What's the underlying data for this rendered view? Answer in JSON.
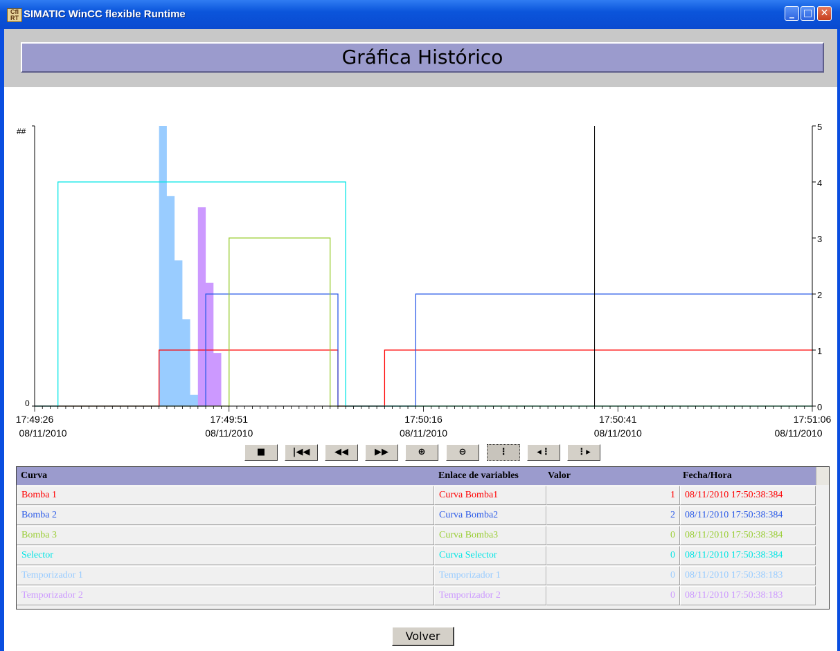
{
  "window": {
    "title": "SIMATIC WinCC flexible Runtime",
    "icon_text": "Cfl RT"
  },
  "header": {
    "title": "Gráfica Histórico"
  },
  "chart_data": {
    "type": "line",
    "step": true,
    "y_left": {
      "label": "##",
      "ticks": [
        "0"
      ]
    },
    "y_right": {
      "ylim": [
        0,
        5
      ],
      "ticks": [
        0,
        1,
        2,
        3,
        4,
        5
      ]
    },
    "x_ticks": [
      {
        "time": "17:49:26",
        "date": "08/11/2010"
      },
      {
        "time": "17:49:51",
        "date": "08/11/2010"
      },
      {
        "time": "17:50:16",
        "date": "08/11/2010"
      },
      {
        "time": "17:50:41",
        "date": "08/11/2010"
      },
      {
        "time": "17:51:06",
        "date": "08/11/2010"
      }
    ],
    "xlim": [
      "17:49:26",
      "17:51:06"
    ],
    "cursor_time": "17:50:38",
    "series": [
      {
        "name": "Bomba 1",
        "color": "#ff0000",
        "type": "line",
        "points": [
          [
            "17:49:26",
            0
          ],
          [
            "17:49:42",
            0
          ],
          [
            "17:49:42",
            1
          ],
          [
            "17:50:05",
            1
          ],
          [
            "17:50:05",
            0
          ],
          [
            "17:50:11",
            0
          ],
          [
            "17:50:11",
            1
          ],
          [
            "17:51:06",
            1
          ]
        ]
      },
      {
        "name": "Bomba 2",
        "color": "#2a5ae8",
        "type": "line",
        "points": [
          [
            "17:49:26",
            0
          ],
          [
            "17:49:48",
            0
          ],
          [
            "17:49:48",
            2
          ],
          [
            "17:50:05",
            2
          ],
          [
            "17:50:05",
            0
          ],
          [
            "17:50:15",
            0
          ],
          [
            "17:50:15",
            2
          ],
          [
            "17:51:06",
            2
          ]
        ]
      },
      {
        "name": "Bomba 3",
        "color": "#9acd32",
        "type": "line",
        "points": [
          [
            "17:49:26",
            0
          ],
          [
            "17:49:51",
            0
          ],
          [
            "17:49:51",
            3
          ],
          [
            "17:50:04",
            3
          ],
          [
            "17:50:04",
            0
          ],
          [
            "17:51:06",
            0
          ]
        ]
      },
      {
        "name": "Selector",
        "color": "#00e5e5",
        "type": "line",
        "points": [
          [
            "17:49:26",
            0
          ],
          [
            "17:49:29",
            0
          ],
          [
            "17:49:29",
            4
          ],
          [
            "17:50:06",
            4
          ],
          [
            "17:50:06",
            0
          ],
          [
            "17:51:06",
            0
          ]
        ]
      },
      {
        "name": "Temporizador 1",
        "color": "#99ccff",
        "type": "area",
        "points": [
          [
            "17:49:42",
            0
          ],
          [
            "17:49:42",
            5
          ],
          [
            "17:49:43",
            5
          ],
          [
            "17:49:43",
            3.75
          ],
          [
            "17:49:44",
            3.75
          ],
          [
            "17:49:44",
            2.6
          ],
          [
            "17:49:45",
            2.6
          ],
          [
            "17:49:45",
            1.55
          ],
          [
            "17:49:46",
            1.55
          ],
          [
            "17:49:46",
            0.2
          ],
          [
            "17:49:48",
            0.2
          ],
          [
            "17:49:48",
            0
          ]
        ]
      },
      {
        "name": "Temporizador 2",
        "color": "#cc99ff",
        "type": "area",
        "points": [
          [
            "17:49:47",
            0
          ],
          [
            "17:49:47",
            3.55
          ],
          [
            "17:49:48",
            3.55
          ],
          [
            "17:49:48",
            2.2
          ],
          [
            "17:49:49",
            2.2
          ],
          [
            "17:49:49",
            0.95
          ],
          [
            "17:49:50",
            0.95
          ],
          [
            "17:49:50",
            0
          ]
        ]
      }
    ]
  },
  "toolbar": {
    "buttons": [
      {
        "name": "stop-button",
        "glyph": "■"
      },
      {
        "name": "first-button",
        "glyph": "|◀◀"
      },
      {
        "name": "rewind-button",
        "glyph": "◀◀"
      },
      {
        "name": "forward-button",
        "glyph": "▶▶"
      },
      {
        "name": "zoom-in-button",
        "glyph": "⊕"
      },
      {
        "name": "zoom-out-button",
        "glyph": "⊖"
      },
      {
        "name": "ruler-button",
        "glyph": "⋮"
      },
      {
        "name": "ruler-back-button",
        "glyph": "◂⋮"
      },
      {
        "name": "ruler-forward-button",
        "glyph": "⋮▸"
      }
    ]
  },
  "table": {
    "columns": [
      "Curva",
      "Enlace de variables",
      "Valor",
      "Fecha/Hora"
    ],
    "rows": [
      {
        "curva": "Bomba 1",
        "enlace": "Curva Bomba1",
        "valor": "1",
        "fecha": "08/11/2010 17:50:38:384",
        "color": "#ff0000"
      },
      {
        "curva": "Bomba 2",
        "enlace": "Curva Bomba2",
        "valor": "2",
        "fecha": "08/11/2010 17:50:38:384",
        "color": "#2a5ae8"
      },
      {
        "curva": "Bomba 3",
        "enlace": "Curva Bomba3",
        "valor": "0",
        "fecha": "08/11/2010 17:50:38:384",
        "color": "#9acd32"
      },
      {
        "curva": "Selector",
        "enlace": "Curva Selector",
        "valor": "0",
        "fecha": "08/11/2010 17:50:38:384",
        "color": "#00e5e5"
      },
      {
        "curva": "Temporizador 1",
        "enlace": "Temporizador 1",
        "valor": "0",
        "fecha": "08/11/2010 17:50:38:183",
        "color": "#99ccff"
      },
      {
        "curva": "Temporizador 2",
        "enlace": "Temporizador 2",
        "valor": "0",
        "fecha": "08/11/2010 17:50:38:183",
        "color": "#cc99ff"
      }
    ]
  },
  "footer": {
    "back_label": "Volver"
  }
}
